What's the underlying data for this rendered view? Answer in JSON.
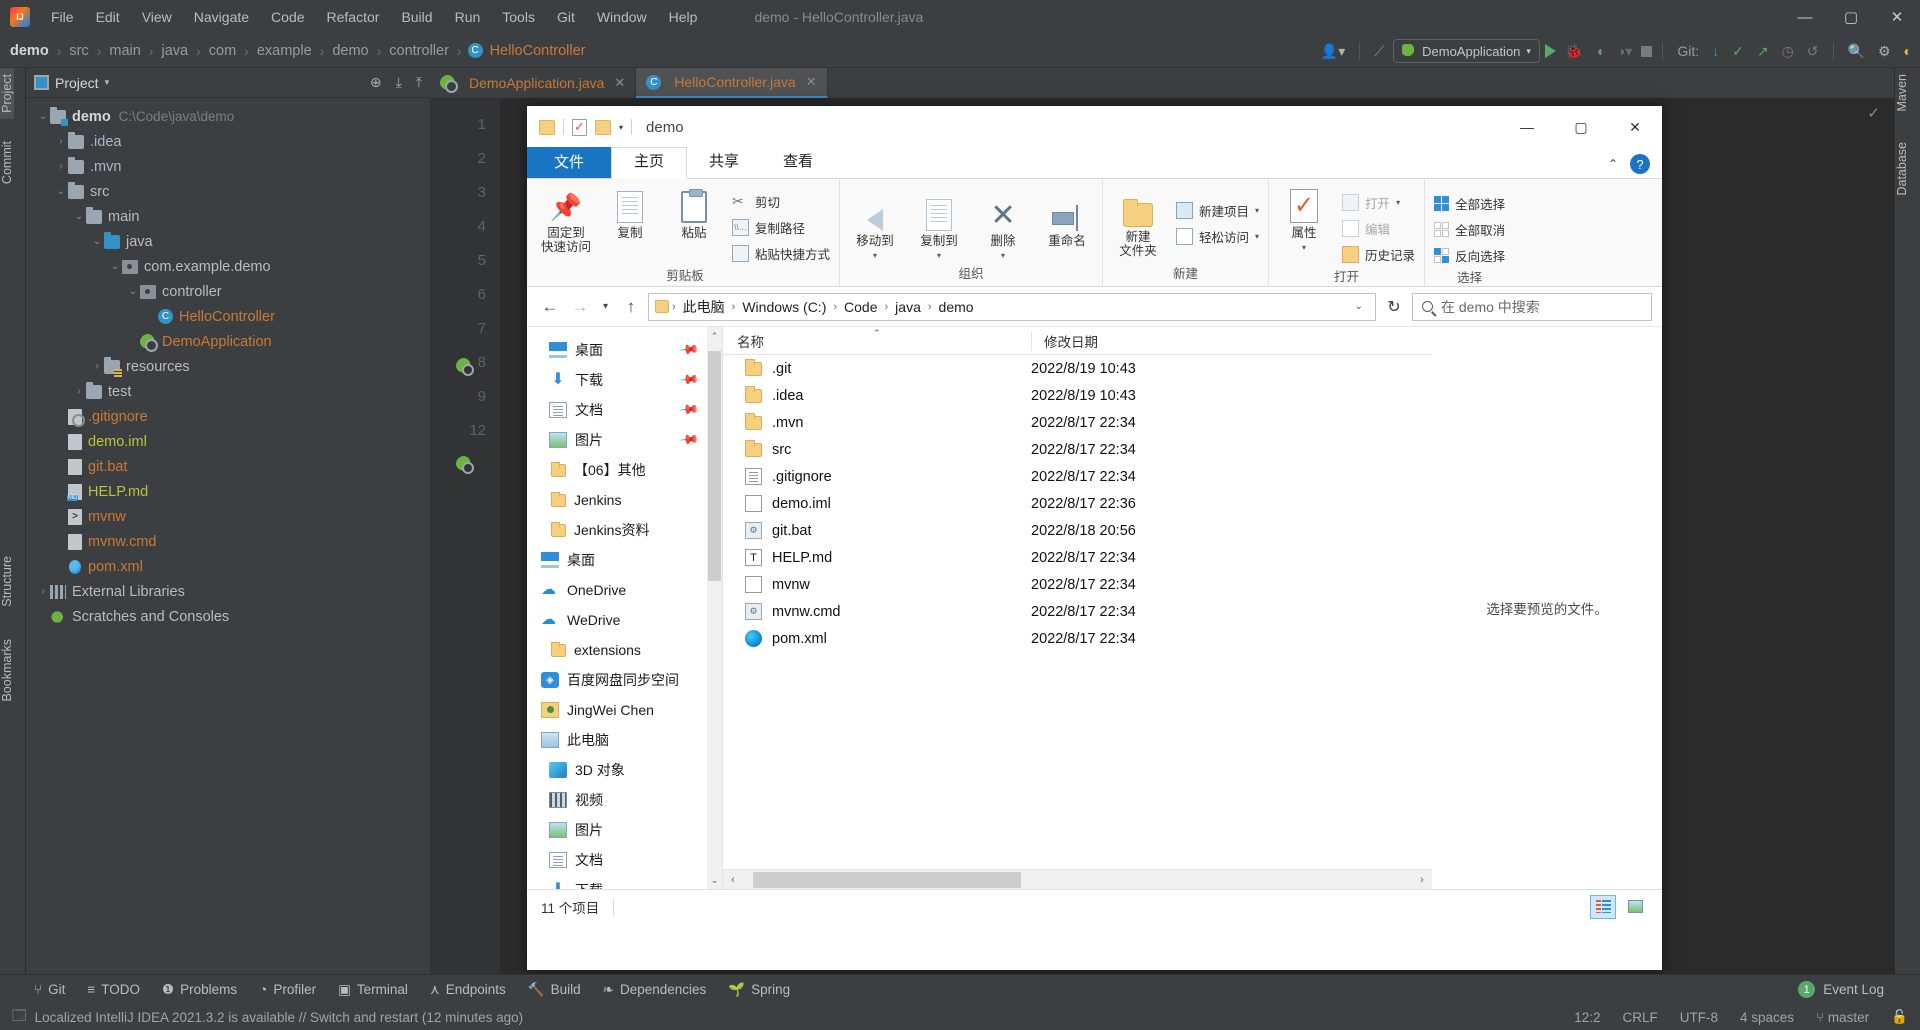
{
  "ide": {
    "menu": [
      "File",
      "Edit",
      "View",
      "Navigate",
      "Code",
      "Refactor",
      "Build",
      "Run",
      "Tools",
      "Git",
      "Window",
      "Help"
    ],
    "window_title": "demo - HelloController.java",
    "window_controls": {
      "minimize": "—",
      "maximize": "▢",
      "close": "✕"
    },
    "breadcrumb": [
      "demo",
      "src",
      "main",
      "java",
      "com",
      "example",
      "demo",
      "controller",
      "HelloController"
    ],
    "toolbar": {
      "run_config": "DemoApplication",
      "git_label": "Git:",
      "run_tooltip": "Run",
      "stop_tooltip": "Stop"
    },
    "left_strips": [
      "Project",
      "Commit",
      "Structure",
      "Bookmarks"
    ],
    "right_strips": [
      "Maven",
      "Database"
    ],
    "project_panel": {
      "title": "Project",
      "tree": [
        {
          "indent": 0,
          "arrow": "v",
          "icon": "folder-module",
          "label": "demo",
          "bold": true,
          "path": "C:\\Code\\java\\demo"
        },
        {
          "indent": 1,
          "arrow": ">",
          "icon": "folder",
          "label": ".idea",
          "color": "yellowish"
        },
        {
          "indent": 1,
          "arrow": ">",
          "icon": "folder",
          "label": ".mvn",
          "color": "yellowish"
        },
        {
          "indent": 1,
          "arrow": "v",
          "icon": "folder",
          "label": "src",
          "color": "plain"
        },
        {
          "indent": 2,
          "arrow": "v",
          "icon": "folder",
          "label": "main",
          "color": "plain"
        },
        {
          "indent": 3,
          "arrow": "v",
          "icon": "folder-source",
          "label": "java",
          "color": "plain"
        },
        {
          "indent": 4,
          "arrow": "v",
          "icon": "package",
          "label": "com.example.demo",
          "color": "plain"
        },
        {
          "indent": 5,
          "arrow": "v",
          "icon": "package",
          "label": "controller",
          "color": "plain"
        },
        {
          "indent": 6,
          "arrow": "",
          "icon": "class",
          "label": "HelloController",
          "color": "orange"
        },
        {
          "indent": 5,
          "arrow": "",
          "icon": "spring-boot",
          "label": "DemoApplication",
          "color": "orange"
        },
        {
          "indent": 3,
          "arrow": ">",
          "icon": "folder-resources",
          "label": "resources",
          "color": "plain"
        },
        {
          "indent": 2,
          "arrow": ">",
          "icon": "folder",
          "label": "test",
          "color": "plain"
        },
        {
          "indent": 1,
          "arrow": "",
          "icon": "file-gitignore",
          "label": ".gitignore",
          "color": "gitign"
        },
        {
          "indent": 1,
          "arrow": "",
          "icon": "file-iml",
          "label": "demo.iml",
          "color": "iml"
        },
        {
          "indent": 1,
          "arrow": "",
          "icon": "file-text",
          "label": "git.bat",
          "color": "orange"
        },
        {
          "indent": 1,
          "arrow": "",
          "icon": "file-md",
          "label": "HELP.md",
          "color": "md"
        },
        {
          "indent": 1,
          "arrow": "",
          "icon": "file-sh",
          "label": "mvnw",
          "color": "orange"
        },
        {
          "indent": 1,
          "arrow": "",
          "icon": "file-text",
          "label": "mvnw.cmd",
          "color": "orange"
        },
        {
          "indent": 1,
          "arrow": "",
          "icon": "file-xml",
          "label": "pom.xml",
          "color": "xmlf"
        },
        {
          "indent": 0,
          "arrow": ">",
          "icon": "libraries",
          "label": "External Libraries",
          "color": "plain"
        },
        {
          "indent": 0,
          "arrow": "",
          "icon": "scratches",
          "label": "Scratches and Consoles",
          "color": "plain"
        }
      ]
    },
    "editor_tabs": [
      {
        "label": "DemoApplication.java",
        "active": false
      },
      {
        "label": "HelloController.java",
        "active": true
      }
    ],
    "gutter_lines": [
      "1",
      "2",
      "3",
      "4",
      "5",
      "6",
      "7",
      "8",
      "9",
      "12"
    ],
    "bottom_tools": [
      {
        "icon": "git-branch-icon",
        "label": "Git"
      },
      {
        "icon": "list-icon",
        "label": "TODO"
      },
      {
        "icon": "warning-icon",
        "label": "Problems"
      },
      {
        "icon": "profiler-icon",
        "label": "Profiler"
      },
      {
        "icon": "terminal-icon",
        "label": "Terminal"
      },
      {
        "icon": "endpoints-icon",
        "label": "Endpoints"
      },
      {
        "icon": "build-icon",
        "label": "Build"
      },
      {
        "icon": "dependencies-icon",
        "label": "Dependencies"
      },
      {
        "icon": "spring-icon",
        "label": "Spring"
      }
    ],
    "event_log": {
      "count": "1",
      "label": "Event Log"
    },
    "status": {
      "message": "Localized IntelliJ IDEA 2021.3.2 is available // Switch and restart (12 minutes ago)",
      "caret": "12:2",
      "line_sep": "CRLF",
      "encoding": "UTF-8",
      "indent": "4 spaces",
      "branch": "master"
    }
  },
  "explorer": {
    "title": "demo",
    "window_controls": {
      "minimize": "—",
      "maximize": "▢",
      "close": "✕"
    },
    "quick_access": {
      "folder": "folder-icon",
      "properties": "properties-icon",
      "newfolder": "new-folder-icon",
      "caret": "▾"
    },
    "tabs": [
      {
        "label": "文件",
        "type": "file"
      },
      {
        "label": "主页",
        "type": "selected"
      },
      {
        "label": "共享",
        "type": "normal"
      },
      {
        "label": "查看",
        "type": "normal"
      }
    ],
    "help_glyph": "?",
    "collapse_glyph": "⌃",
    "ribbon": [
      {
        "name": "剪贴板",
        "big": [
          {
            "icon": "pin-icon",
            "label": "固定到\n快速访问"
          },
          {
            "icon": "copy-icon",
            "label": "复制"
          },
          {
            "icon": "paste-icon",
            "label": "粘贴"
          }
        ],
        "small": [
          {
            "icon": "scissors-icon",
            "label": "剪切"
          },
          {
            "icon": "copy-path-icon",
            "label": "复制路径"
          },
          {
            "icon": "paste-shortcut-icon",
            "label": "粘贴快捷方式"
          }
        ]
      },
      {
        "name": "组织",
        "big": [
          {
            "icon": "move-to-icon",
            "label": "移动到",
            "caret": true
          },
          {
            "icon": "copy-to-icon",
            "label": "复制到",
            "caret": true
          },
          {
            "icon": "delete-icon",
            "label": "删除",
            "caret": true
          },
          {
            "icon": "rename-icon",
            "label": "重命名"
          }
        ],
        "small": []
      },
      {
        "name": "新建",
        "big": [
          {
            "icon": "new-folder-icon",
            "label": "新建\n文件夹"
          }
        ],
        "small": [
          {
            "icon": "new-item-icon",
            "label": "新建项目",
            "caret": true
          },
          {
            "icon": "easy-access-icon",
            "label": "轻松访问",
            "caret": true
          }
        ]
      },
      {
        "name": "打开",
        "big": [
          {
            "icon": "properties-icon",
            "label": "属性",
            "caret": true
          }
        ],
        "small": [
          {
            "icon": "open-icon",
            "label": "打开",
            "caret": true,
            "dim": true
          },
          {
            "icon": "edit-icon",
            "label": "编辑",
            "dim": true
          },
          {
            "icon": "history-icon",
            "label": "历史记录"
          }
        ]
      },
      {
        "name": "选择",
        "big": [],
        "small": [
          {
            "icon": "select-all-icon",
            "label": "全部选择"
          },
          {
            "icon": "select-none-icon",
            "label": "全部取消"
          },
          {
            "icon": "invert-selection-icon",
            "label": "反向选择"
          }
        ]
      }
    ],
    "address": {
      "back": "←",
      "forward": "→",
      "recent": "▾",
      "up": "↑",
      "crumbs": [
        "此电脑",
        "Windows (C:)",
        "Code",
        "java",
        "demo"
      ],
      "dropdown": "⌄",
      "refresh": "↻"
    },
    "search": {
      "placeholder": "在 demo 中搜索",
      "icon": "search-icon"
    },
    "nav_pane": [
      {
        "icon": "desktop-icon",
        "label": "桌面",
        "pinned": true,
        "indent": 1
      },
      {
        "icon": "download-icon",
        "label": "下载",
        "pinned": true,
        "indent": 1
      },
      {
        "icon": "documents-icon",
        "label": "文档",
        "pinned": true,
        "indent": 1
      },
      {
        "icon": "pictures-icon",
        "label": "图片",
        "pinned": true,
        "indent": 1
      },
      {
        "icon": "folder-icon",
        "label": "【06】其他",
        "pinned": false,
        "indent": 1
      },
      {
        "icon": "folder-icon",
        "label": "Jenkins",
        "pinned": false,
        "indent": 1
      },
      {
        "icon": "folder-icon",
        "label": "Jenkins资料",
        "pinned": false,
        "indent": 1
      },
      {
        "icon": "desktop-icon",
        "label": "桌面",
        "pinned": false,
        "indent": 0
      },
      {
        "icon": "onedrive-icon",
        "label": "OneDrive",
        "pinned": false,
        "indent": 0
      },
      {
        "icon": "wedrive-icon",
        "label": "WeDrive",
        "pinned": false,
        "indent": 0
      },
      {
        "icon": "folder-icon",
        "label": "extensions",
        "pinned": false,
        "indent": 1
      },
      {
        "icon": "baidu-netdisk-icon",
        "label": "百度网盘同步空间",
        "pinned": false,
        "indent": 0
      },
      {
        "icon": "user-folder-icon",
        "label": "JingWei Chen",
        "pinned": false,
        "indent": 0
      },
      {
        "icon": "this-pc-icon",
        "label": "此电脑",
        "pinned": false,
        "indent": 0
      },
      {
        "icon": "3d-objects-icon",
        "label": "3D 对象",
        "pinned": false,
        "indent": 1
      },
      {
        "icon": "videos-icon",
        "label": "视频",
        "pinned": false,
        "indent": 1
      },
      {
        "icon": "pictures-icon",
        "label": "图片",
        "pinned": false,
        "indent": 1
      },
      {
        "icon": "documents-icon",
        "label": "文档",
        "pinned": false,
        "indent": 1
      },
      {
        "icon": "download-icon",
        "label": "下载",
        "pinned": false,
        "indent": 1
      }
    ],
    "columns": {
      "name": "名称",
      "date": "修改日期"
    },
    "files": [
      {
        "icon": "folder-icon",
        "name": ".git",
        "date": "2022/8/19 10:43"
      },
      {
        "icon": "folder-icon",
        "name": ".idea",
        "date": "2022/8/19 10:43"
      },
      {
        "icon": "folder-icon",
        "name": ".mvn",
        "date": "2022/8/17 22:34"
      },
      {
        "icon": "folder-icon",
        "name": "src",
        "date": "2022/8/17 22:34"
      },
      {
        "icon": "text-file-icon",
        "name": ".gitignore",
        "date": "2022/8/17 22:34"
      },
      {
        "icon": "blank-file-icon",
        "name": "demo.iml",
        "date": "2022/8/17 22:36"
      },
      {
        "icon": "cmd-file-icon",
        "name": "git.bat",
        "date": "2022/8/18 20:56"
      },
      {
        "icon": "md-file-icon",
        "name": "HELP.md",
        "date": "2022/8/17 22:34"
      },
      {
        "icon": "blank-file-icon",
        "name": "mvnw",
        "date": "2022/8/17 22:34"
      },
      {
        "icon": "cmd-file-icon",
        "name": "mvnw.cmd",
        "date": "2022/8/17 22:34"
      },
      {
        "icon": "edge-file-icon",
        "name": "pom.xml",
        "date": "2022/8/17 22:34"
      }
    ],
    "preview_text": "选择要预览的文件。",
    "status_text": "11 个项目",
    "view_buttons": [
      {
        "icon": "details-view-icon",
        "active": true
      },
      {
        "icon": "large-icons-view-icon",
        "active": false
      }
    ]
  },
  "colors": {
    "ide_bg": "#3c3f41",
    "editor_bg": "#2b2b2b",
    "accent_blue": "#3592c4",
    "ribbon_blue": "#1a74c4",
    "orange_text": "#cc7832",
    "green": "#59a869"
  }
}
